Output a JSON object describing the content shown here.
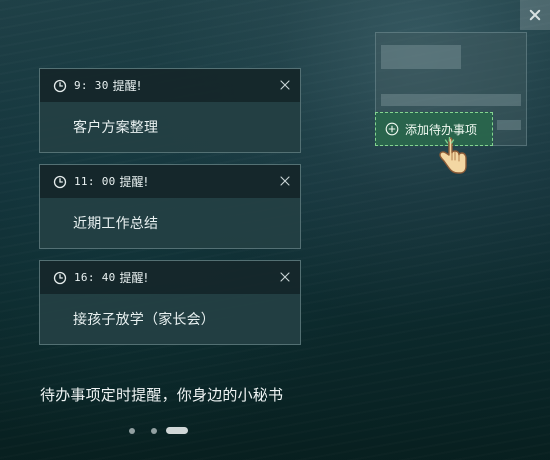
{
  "reminders": [
    {
      "time": "9: 30",
      "remind_label": "提醒!",
      "task": "客户方案整理"
    },
    {
      "time": "11: 00",
      "remind_label": "提醒!",
      "task": "近期工作总结"
    },
    {
      "time": "16: 40",
      "remind_label": "提醒!",
      "task": "接孩子放学（家长会）"
    }
  ],
  "add_button": {
    "label": "添加待办事项"
  },
  "tagline": "待办事项定时提醒，你身边的小秘书",
  "pagination": {
    "active_index": 3,
    "total": 3
  },
  "icons": {
    "window_close": "close-icon",
    "reminder_time": "clock-icon",
    "reminder_close": "close-icon",
    "add_todo": "plus-circle-icon",
    "pointer": "hand-pointer-icon"
  },
  "colors": {
    "accent_green": "#83d48f",
    "button_fill": "#28674b",
    "background_dark": "#0b2a2d"
  }
}
